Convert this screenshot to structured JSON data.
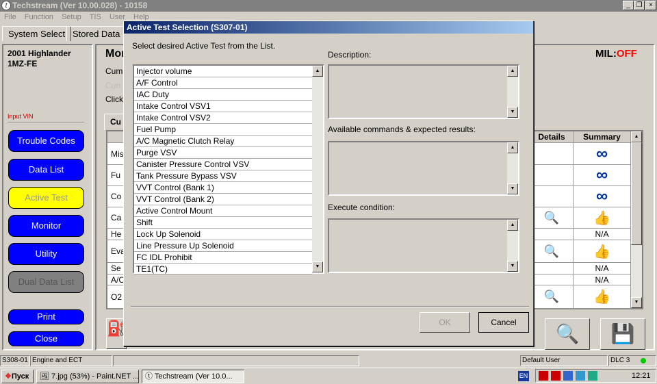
{
  "window": {
    "title": "Techstream (Ver 10.00.028) - 10158"
  },
  "menu": [
    "File",
    "Function",
    "Setup",
    "TIS",
    "User",
    "Help"
  ],
  "tabs": [
    "System Select",
    "Stored Data"
  ],
  "vehicle": {
    "model": "2001 Highlander",
    "engine": "1MZ-FE",
    "input_vin": "Input VIN"
  },
  "sidebar": {
    "buttons": [
      {
        "label": "Trouble Codes",
        "state": "normal"
      },
      {
        "label": "Data List",
        "state": "normal"
      },
      {
        "label": "Active Test",
        "state": "active"
      },
      {
        "label": "Monitor",
        "state": "normal"
      },
      {
        "label": "Utility",
        "state": "normal"
      },
      {
        "label": "Dual Data List",
        "state": "disabled"
      }
    ],
    "print": "Print",
    "close": "Close"
  },
  "main": {
    "heading": "Mon",
    "lines": [
      "Cum",
      "Curr",
      "Click"
    ],
    "mil_label": "MIL:",
    "mil_value": "OFF",
    "mil_color": "#ff0000",
    "table_tab": "Cu",
    "columns": [
      "Details",
      "Summary"
    ],
    "rows": [
      {
        "name": "Mis",
        "details": "",
        "summary": "infinity"
      },
      {
        "name": "Fu",
        "details": "",
        "summary": "infinity"
      },
      {
        "name": "Co",
        "details": "",
        "summary": "infinity"
      },
      {
        "name": "Ca",
        "details": "magnifier",
        "summary": "thumbs-up"
      },
      {
        "name": "He",
        "details": "",
        "summary": "N/A"
      },
      {
        "name": "Eva",
        "details": "magnifier",
        "summary": "thumbs-up"
      },
      {
        "name": "Se",
        "details": "",
        "summary": "N/A"
      },
      {
        "name": "A/C",
        "details": "",
        "summary": "N/A"
      },
      {
        "name": "O2",
        "details": "magnifier",
        "summary": "thumbs-up"
      }
    ]
  },
  "dialog": {
    "title": "Active Test Selection (S307-01)",
    "prompt": "Select desired Active Test from the List.",
    "items": [
      "Injector volume",
      "A/F Control",
      "IAC Duty",
      "Intake Control VSV1",
      "Intake Control VSV2",
      "Fuel Pump",
      "A/C Magnetic Clutch Relay",
      "Purge VSV",
      "Canister Pressure Control VSV",
      "Tank Pressure Bypass VSV",
      "VVT Control (Bank 1)",
      "VVT Control (Bank 2)",
      "Active Control Mount",
      "Shift",
      "Lock Up Solenoid",
      "Line Pressure Up Solenoid",
      "FC IDL Prohibit",
      "TE1(TC)"
    ],
    "description_label": "Description:",
    "commands_label": "Available commands & expected results:",
    "condition_label": "Execute condition:",
    "ok": "OK",
    "cancel": "Cancel"
  },
  "statusbar": {
    "code": "S308-01",
    "system": "Engine and ECT",
    "user": "Default User",
    "dlc": "DLC 3",
    "dlc_color": "#00cc00"
  },
  "taskbar": {
    "start": "Пуск",
    "items": [
      "7.jpg (53%) - Paint.NET ...",
      "Techstream (Ver 10.0..."
    ],
    "lang": "EN",
    "time": "12:21"
  }
}
